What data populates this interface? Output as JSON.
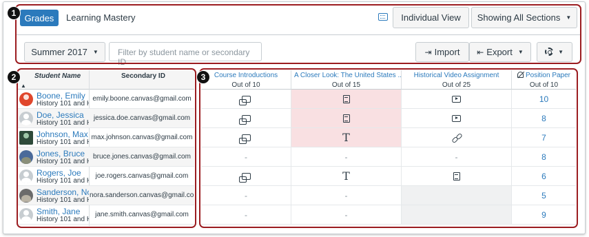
{
  "header": {
    "tabs": [
      {
        "label": "Grades",
        "active": true
      },
      {
        "label": "Learning Mastery",
        "active": false
      }
    ],
    "individual_view_label": "Individual View",
    "sections_label": "Showing All Sections"
  },
  "toolbar": {
    "term": "Summer 2017",
    "filter_placeholder": "Filter by student name or secondary ID",
    "import_label": "Import",
    "export_label": "Export"
  },
  "callouts": [
    "1",
    "2",
    "3"
  ],
  "student_grid": {
    "col_name": "Student Name",
    "col_secondary": "Secondary ID",
    "rows": [
      {
        "name": "Boone, Emily",
        "section": "History 101 and H",
        "email": "emily.boone.canvas@gmail.com"
      },
      {
        "name": "Doe, Jessica",
        "section": "History 101 and H",
        "email": "jessica.doe.canvas@gmail.com"
      },
      {
        "name": "Johnson, Max",
        "section": "History 101 and H",
        "email": "max.johnson.canvas@gmail.com"
      },
      {
        "name": "Jones, Bruce",
        "section": "History 101 and H",
        "email": "bruce.jones.canvas@gmail.com"
      },
      {
        "name": "Rogers, Joe",
        "section": "History 101 and H",
        "email": "joe.rogers.canvas@gmail.com"
      },
      {
        "name": "Sanderson, Nor",
        "section": "History 101 and H",
        "email": "nora.sanderson.canvas@gmail.com"
      },
      {
        "name": "Smith, Jane",
        "section": "History 101 and H",
        "email": "jane.smith.canvas@gmail.com"
      }
    ]
  },
  "assignments": [
    {
      "title": "Course Introductions",
      "points": "Out of 10"
    },
    {
      "title": "A Closer Look: The United States ...",
      "points": "Out of 15"
    },
    {
      "title": "Historical Video Assignment",
      "points": "Out of 25"
    },
    {
      "title": "Position Paper",
      "points": "Out of 10",
      "muted": true
    }
  ],
  "cells": [
    [
      "discussion-icon",
      "document-icon",
      "media-icon",
      "10"
    ],
    [
      "discussion-icon",
      "document-icon",
      "media-icon",
      "8"
    ],
    [
      "discussion-icon",
      "text-icon",
      "link-icon",
      "7"
    ],
    [
      "-",
      "-",
      "-",
      "8"
    ],
    [
      "discussion-icon",
      "text-icon",
      "document-icon",
      "6"
    ],
    [
      "-",
      "-",
      "",
      "5"
    ],
    [
      "-",
      "-",
      "",
      "9"
    ]
  ],
  "text_entry_glyph": "T",
  "colors": {
    "accent": "#2b7abc",
    "late_highlight": "#f9e0e2",
    "callout_border": "#9b1c20"
  }
}
